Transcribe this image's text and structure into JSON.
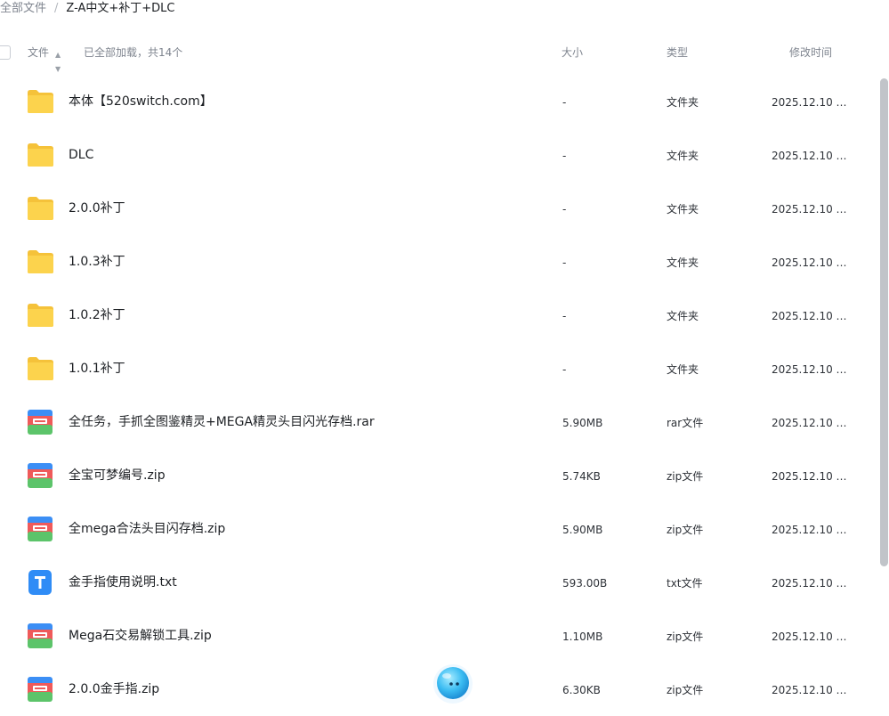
{
  "breadcrumb": {
    "root": "全部文件",
    "separator": "/",
    "current": "Z-A中文+补丁+DLC"
  },
  "list_header": {
    "name_label": "文件",
    "sort_icon": "sort-caret-icon",
    "load_status": "已全部加载，共14个",
    "size_label": "大小",
    "type_label": "类型",
    "modified_label": "修改时间"
  },
  "colors": {
    "folder": "#fcd34d",
    "archive_top": "#3b8ef5",
    "archive_mid": "#ef5a5a",
    "archive_bottom": "#5cc46a",
    "text_file": "#2f8cf6"
  },
  "files": [
    {
      "name": "本体【520switch.com】",
      "size": "-",
      "type": "文件夹",
      "modified": "2025.12.10 2...",
      "icon": "folder-icon"
    },
    {
      "name": "DLC",
      "size": "-",
      "type": "文件夹",
      "modified": "2025.12.10 2...",
      "icon": "folder-icon"
    },
    {
      "name": "2.0.0补丁",
      "size": "-",
      "type": "文件夹",
      "modified": "2025.12.10 2...",
      "icon": "folder-icon"
    },
    {
      "name": "1.0.3补丁",
      "size": "-",
      "type": "文件夹",
      "modified": "2025.12.10 2...",
      "icon": "folder-icon"
    },
    {
      "name": "1.0.2补丁",
      "size": "-",
      "type": "文件夹",
      "modified": "2025.12.10 2...",
      "icon": "folder-icon"
    },
    {
      "name": "1.0.1补丁",
      "size": "-",
      "type": "文件夹",
      "modified": "2025.12.10 2...",
      "icon": "folder-icon"
    },
    {
      "name": "全任务，手抓全图鉴精灵+MEGA精灵头目闪光存档.rar",
      "size": "5.90MB",
      "type": "rar文件",
      "modified": "2025.12.10 2...",
      "icon": "archive-icon"
    },
    {
      "name": "全宝可梦编号.zip",
      "size": "5.74KB",
      "type": "zip文件",
      "modified": "2025.12.10 2...",
      "icon": "archive-icon"
    },
    {
      "name": "全mega合法头目闪存档.zip",
      "size": "5.90MB",
      "type": "zip文件",
      "modified": "2025.12.10 2...",
      "icon": "archive-icon"
    },
    {
      "name": "金手指使用说明.txt",
      "size": "593.00B",
      "type": "txt文件",
      "modified": "2025.12.10 2...",
      "icon": "text-file-icon"
    },
    {
      "name": "Mega石交易解锁工具.zip",
      "size": "1.10MB",
      "type": "zip文件",
      "modified": "2025.12.10 2...",
      "icon": "archive-icon"
    },
    {
      "name": "2.0.0金手指.zip",
      "size": "6.30KB",
      "type": "zip文件",
      "modified": "2025.12.10 2...",
      "icon": "archive-icon"
    }
  ],
  "overlay": {
    "assistant_icon": "assistant-bubble-icon"
  }
}
